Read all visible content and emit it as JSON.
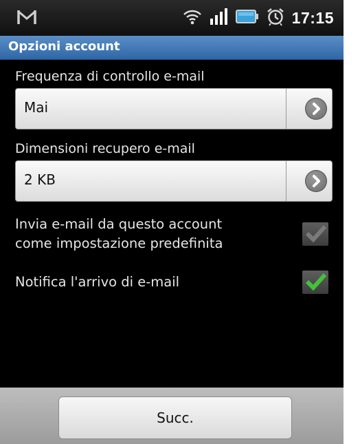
{
  "status_bar": {
    "time": "17:15",
    "icons": [
      "gmail-icon",
      "wifi-icon",
      "signal-icon",
      "battery-icon",
      "alarm-icon"
    ]
  },
  "title_bar": {
    "title": "Opzioni account"
  },
  "settings": {
    "check_frequency": {
      "label": "Frequenza di controllo e-mail",
      "value": "Mai"
    },
    "retrieval_size": {
      "label": "Dimensioni recupero e-mail",
      "value": "2 KB"
    },
    "default_account": {
      "label_line1": "Invia e-mail da questo account",
      "label_line2": "come impostazione predefinita",
      "checked": true,
      "enabled": false
    },
    "notify": {
      "label": "Notifica l'arrivo di e-mail",
      "checked": true,
      "enabled": true
    }
  },
  "bottom_bar": {
    "next_label": "Succ."
  },
  "colors": {
    "title_bar": "#3a72b0",
    "check_enabled": "#43c13a",
    "check_disabled": "#7a7a7a",
    "background": "#000000"
  }
}
